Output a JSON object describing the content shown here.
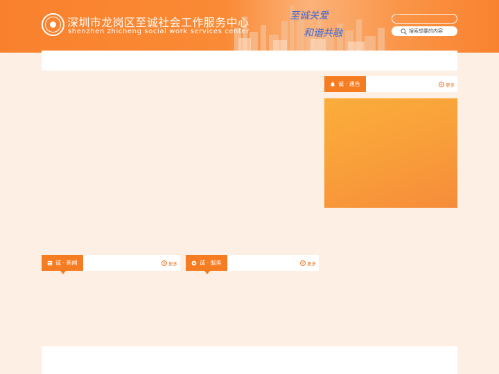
{
  "header": {
    "title": "深圳市龙岗区至诚社会工作服务中心",
    "subtitle": "shenzhen zhicheng social work services center",
    "slogan_line1": "至诚关爱",
    "slogan_line2": "和谐共融",
    "brand_color": "#f9812d",
    "search": {
      "placeholder": "搜索想要的内容"
    }
  },
  "notice": {
    "label": "诚 · 通告",
    "more": "更多",
    "icon": "bell-icon"
  },
  "news": {
    "label": "诚 · 新闻",
    "more": "更多",
    "icon": "newspaper-icon"
  },
  "service": {
    "label": "诚 · 服务",
    "more": "更多",
    "icon": "gear-icon"
  },
  "colors": {
    "tab_orange": "#f57c21",
    "page_bg": "#fdefe4",
    "notice_image": "#f9a23a"
  }
}
